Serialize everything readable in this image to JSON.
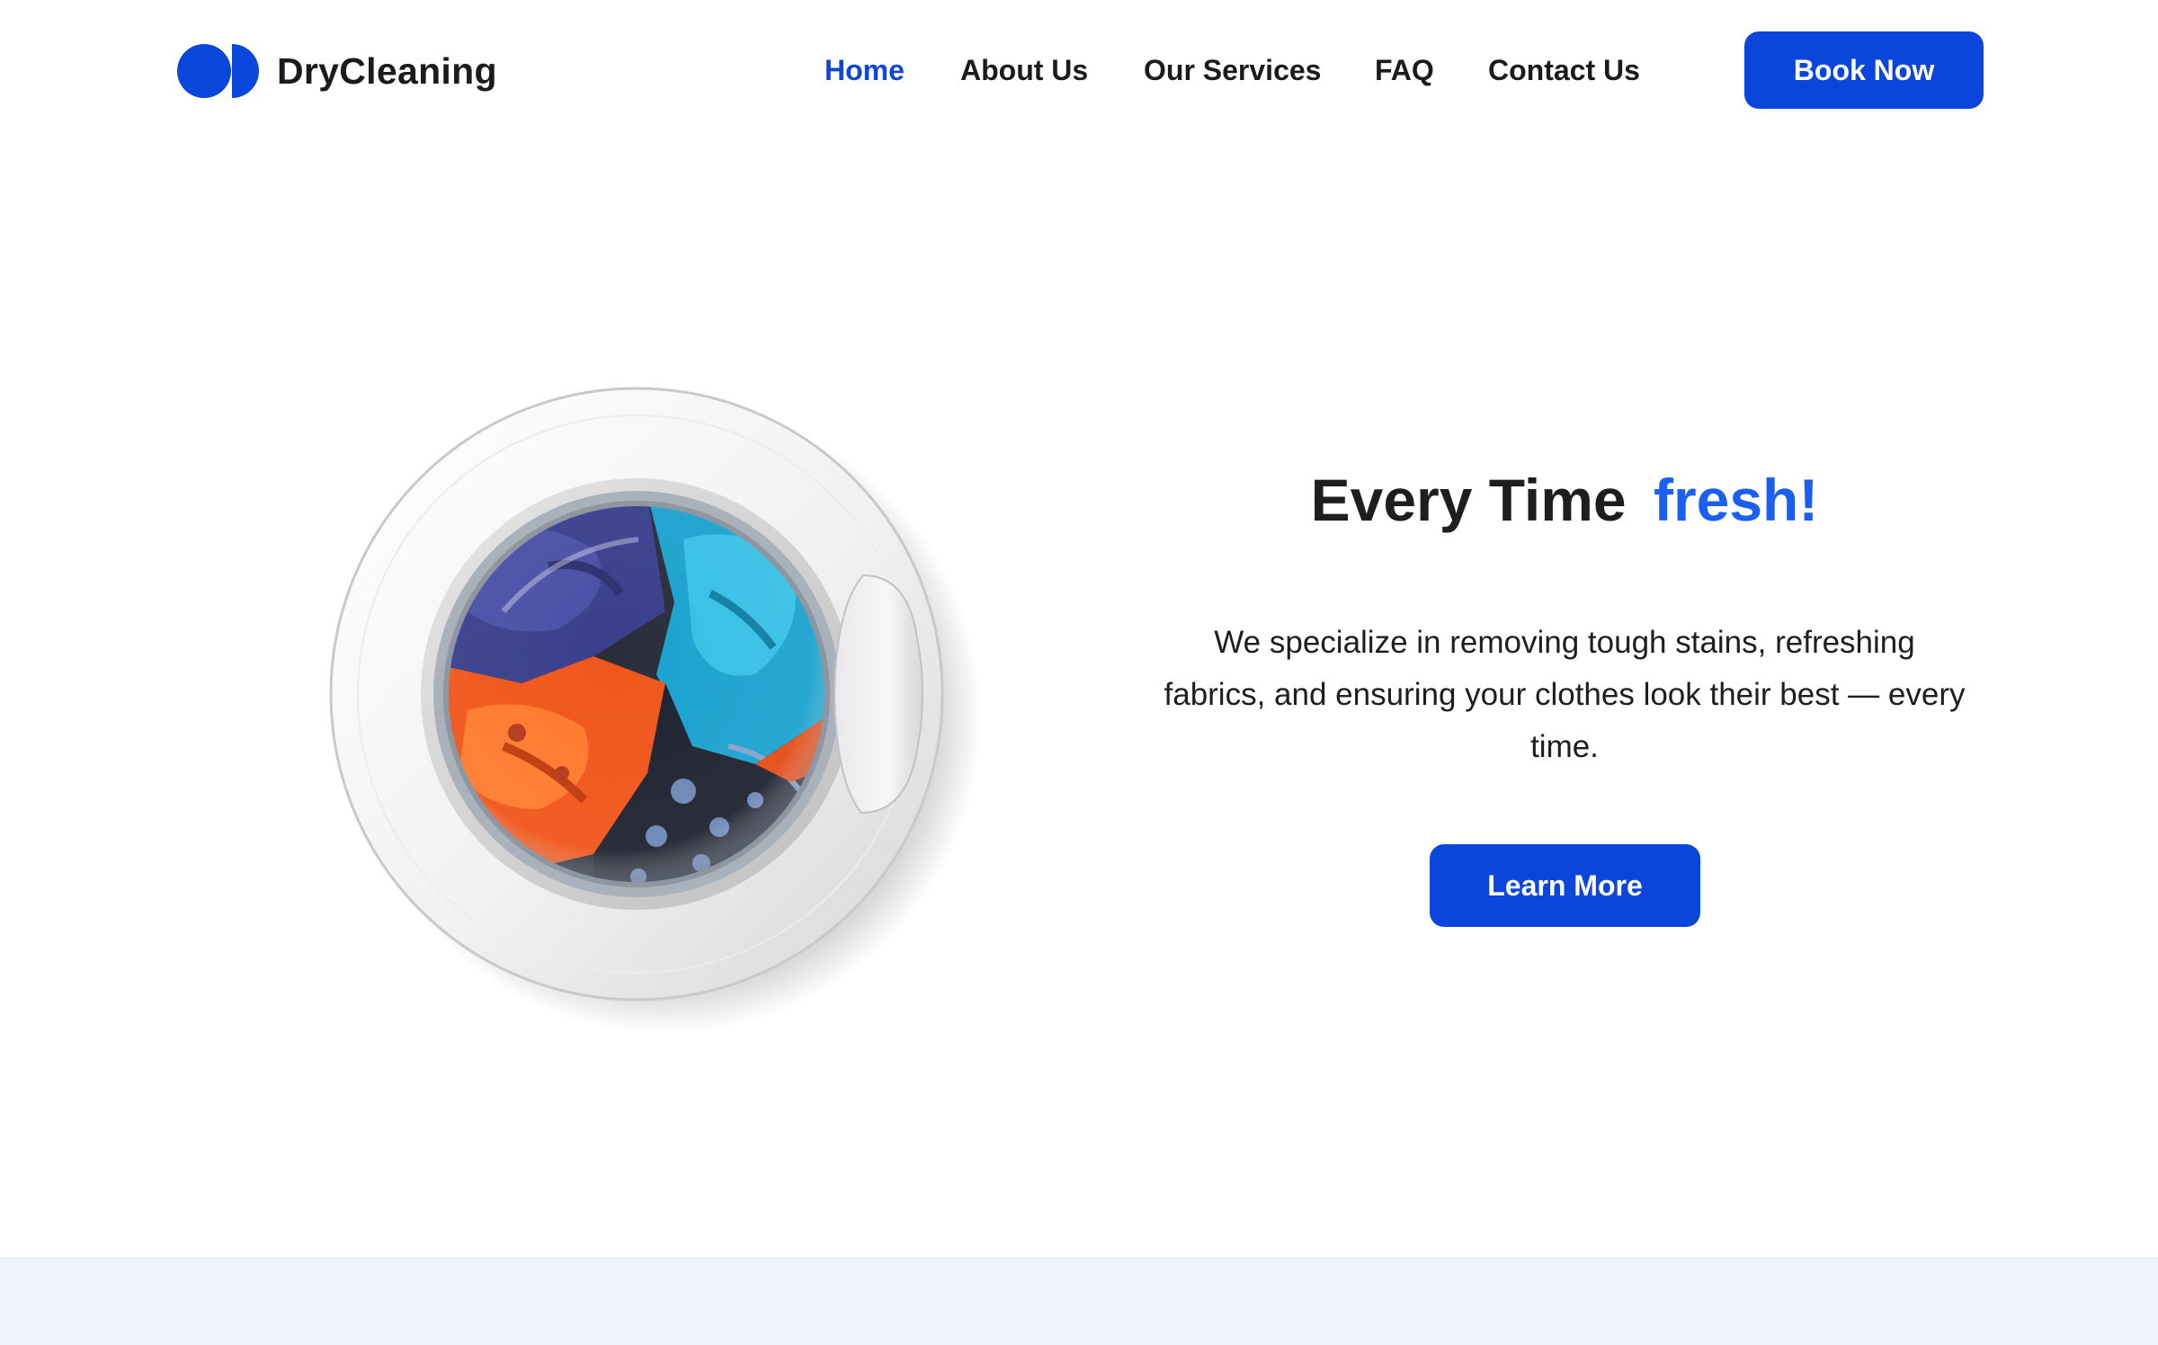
{
  "brand": {
    "name": "DryCleaning",
    "accent_color": "#0a46dc"
  },
  "nav": {
    "items": [
      {
        "label": "Home",
        "active": true
      },
      {
        "label": "About Us",
        "active": false
      },
      {
        "label": "Our Services",
        "active": false
      },
      {
        "label": "FAQ",
        "active": false
      },
      {
        "label": "Contact Us",
        "active": false
      }
    ],
    "cta_label": "Book Now"
  },
  "hero": {
    "title_main": "Every Time",
    "title_accent": "fresh!",
    "title_accent_color": "#1a5ff0",
    "body": "We specialize in removing tough stains, refreshing fabrics, and ensuring your clothes look their best — every time.",
    "cta_label": "Learn More",
    "image_icon": "washing-machine-door-icon"
  },
  "colors": {
    "nav_active": "#1145d6",
    "button_bg": "#0a46dc",
    "bottom_band": "#eff3fb"
  }
}
